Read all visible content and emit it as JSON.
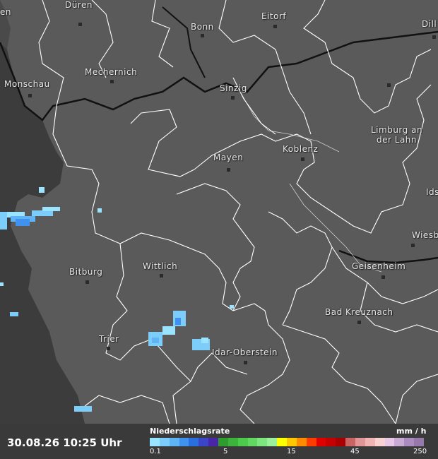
{
  "timestamp": "30.08.26 10:25 Uhr",
  "legend": {
    "title": "Niederschlagsrate",
    "unit": "mm / h",
    "ticks": [
      "0.1",
      "5",
      "15",
      "45",
      "250"
    ],
    "colors": [
      "#9be4ff",
      "#7dcdfb",
      "#5fb4f5",
      "#3f92ee",
      "#2a6fe0",
      "#3a45c8",
      "#4a25a8",
      "#2e9c2e",
      "#3cb43c",
      "#4cca4c",
      "#62d862",
      "#7ee67e",
      "#9cf09c",
      "#ffff00",
      "#ffc800",
      "#ff8c00",
      "#ff3c00",
      "#e00000",
      "#c40000",
      "#a80000",
      "#c86464",
      "#e09696",
      "#f0b4b4",
      "#f8d2d2",
      "#e6c8e6",
      "#c8aad2",
      "#aa8cbe",
      "#9678aa"
    ]
  },
  "cities": [
    {
      "name": "Düren"
    },
    {
      "name": "Eitorf"
    },
    {
      "name": "Dill"
    },
    {
      "name": "Bonn"
    },
    {
      "name": "Mechernich"
    },
    {
      "name": "Monschau"
    },
    {
      "name": "Sinzig"
    },
    {
      "name": "Limburg an\nder Lahn"
    },
    {
      "name": "Mayen"
    },
    {
      "name": "Koblenz"
    },
    {
      "name": "Ids"
    },
    {
      "name": "Wiesb"
    },
    {
      "name": "Bitburg"
    },
    {
      "name": "Wittlich"
    },
    {
      "name": "Geisenheim"
    },
    {
      "name": "Bad Kreuznach"
    },
    {
      "name": "Trier"
    },
    {
      "name": "Idar-Oberstein"
    },
    {
      "name": "en"
    }
  ],
  "colors": {
    "land": "#5a5a5a",
    "outside": "#3c3c3c",
    "borders": "#ffffff",
    "state_border": "#111111"
  }
}
